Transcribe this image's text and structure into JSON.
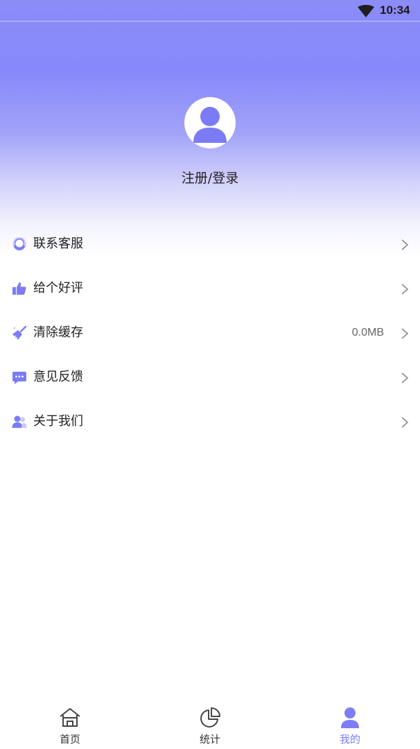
{
  "status_bar": {
    "time": "10:34"
  },
  "profile": {
    "login_label": "注册/登录"
  },
  "menu": {
    "items": [
      {
        "icon": "customer-service-icon",
        "label": "联系客服",
        "value": ""
      },
      {
        "icon": "thumbs-up-icon",
        "label": "给个好评",
        "value": ""
      },
      {
        "icon": "broom-icon",
        "label": "清除缓存",
        "value": "0.0MB"
      },
      {
        "icon": "chat-bubble-icon",
        "label": "意见反馈",
        "value": ""
      },
      {
        "icon": "users-icon",
        "label": "关于我们",
        "value": ""
      }
    ]
  },
  "tabbar": {
    "tabs": [
      {
        "icon": "home-icon",
        "label": "首页",
        "active": false
      },
      {
        "icon": "pie-chart-icon",
        "label": "统计",
        "active": false
      },
      {
        "icon": "person-icon",
        "label": "我的",
        "active": true
      }
    ]
  },
  "colors": {
    "accent": "#7d7ef7",
    "hero_top": "#8788fb",
    "icon_purple": "#7b7cf5"
  }
}
